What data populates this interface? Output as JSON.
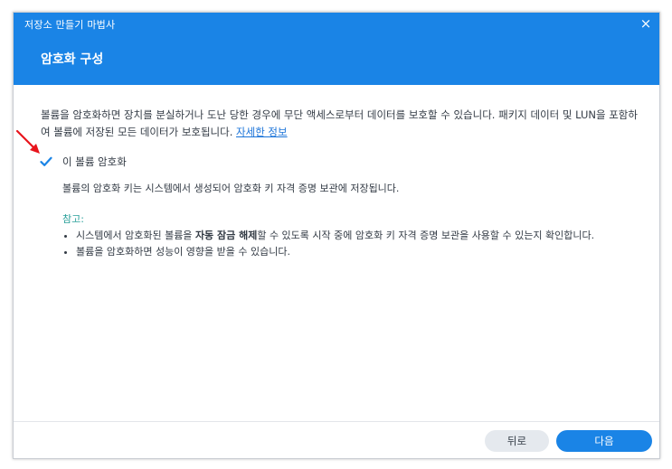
{
  "wizard": {
    "title": "저장소 만들기 마법사",
    "step_title": "암호화 구성",
    "close_icon": "×"
  },
  "content": {
    "description": "볼륨을 암호화하면 장치를 분실하거나 도난 당한 경우에 무단 액세스로부터 데이터를 보호할 수 있습니다. 패키지 데이터 및 LUN을 포함하여 볼륨에 저장된 모든 데이터가 보호됩니다. ",
    "learn_more_link": "자세한 정보",
    "checkbox_label": "이 볼륨 암호화",
    "checkbox_checked": true,
    "key_info": "볼륨의 암호화 키는 시스템에서 생성되어 암호화 키 자격 증명 보관에 저장됩니다.",
    "note_title": "참고:",
    "note1_pre": "시스템에서 암호화된 볼륨을 ",
    "note1_bold": "자동 잠금 해제",
    "note1_post": "할 수 있도록 시작 중에 암호화 키 자격 증명 보관을 사용할 수 있는지 확인합니다.",
    "note2": "볼륨을 암호화하면 성능이 영향을 받을 수 있습니다."
  },
  "footer": {
    "back_label": "뒤로",
    "next_label": "다음"
  },
  "colors": {
    "header": "#1a84e6",
    "primary_button": "#1a84e6",
    "note_title": "#2aa09a",
    "annotation_arrow": "#e8141c"
  }
}
